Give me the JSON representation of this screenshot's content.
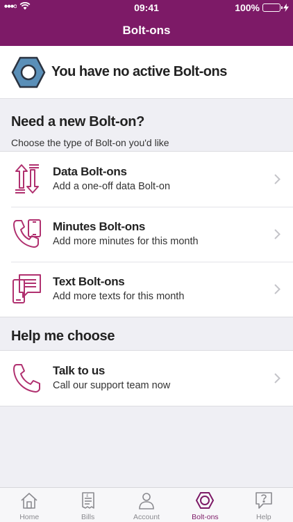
{
  "status_bar": {
    "time": "09:41",
    "battery_pct": "100%",
    "battery_level": 1.0
  },
  "header": {
    "title": "Bolt-ons"
  },
  "status_card": {
    "message": "You have no active Bolt-ons"
  },
  "new_boltons": {
    "title": "Need a new Bolt-on?",
    "subtitle": "Choose the type of Bolt-on you'd like",
    "items": [
      {
        "title": "Data Bolt-ons",
        "desc": "Add a one-off data Bolt-on",
        "icon": "data-arrows-icon"
      },
      {
        "title": "Minutes Bolt-ons",
        "desc": "Add more minutes for this month",
        "icon": "phone-minutes-icon"
      },
      {
        "title": "Text Bolt-ons",
        "desc": "Add more texts for this month",
        "icon": "text-message-icon"
      }
    ]
  },
  "help": {
    "title": "Help me choose",
    "items": [
      {
        "title": "Talk to us",
        "desc": "Call our support team now",
        "icon": "phone-icon"
      }
    ]
  },
  "tabbar": {
    "tabs": [
      {
        "label": "Home",
        "icon": "home-icon",
        "active": false
      },
      {
        "label": "Bills",
        "icon": "bills-icon",
        "active": false
      },
      {
        "label": "Account",
        "icon": "account-icon",
        "active": false
      },
      {
        "label": "Bolt-ons",
        "icon": "bolt-nut-icon",
        "active": true
      },
      {
        "label": "Help",
        "icon": "help-icon",
        "active": false
      }
    ]
  },
  "colors": {
    "brand": "#7d1a67",
    "accent_icon": "#b0306f",
    "hex_fill": "#5a8fb8",
    "background": "#efeff4"
  }
}
